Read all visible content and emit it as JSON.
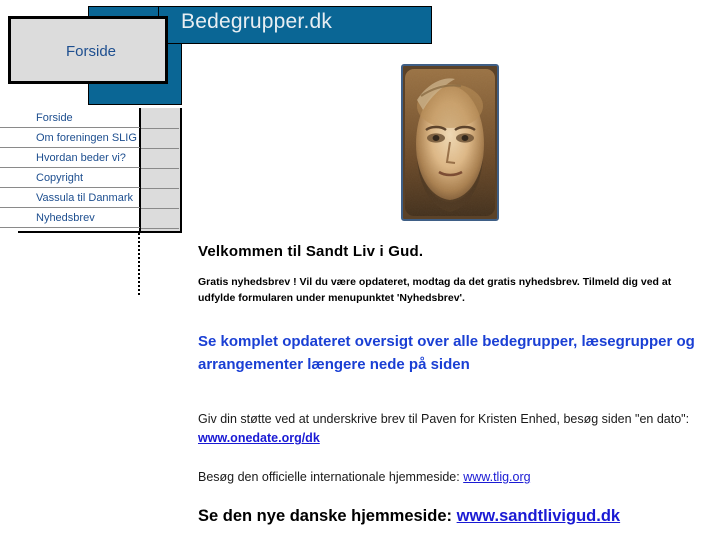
{
  "site": {
    "banner_title": "Bedegrupper.dk",
    "tab_label": "Forside",
    "accent_blue": "#0a6695",
    "link_blue": "#1a1ad4",
    "heading_blue": "#1a3fd4",
    "menu_text_blue": "#1d4e8f",
    "panel_grey": "#dcdcdc"
  },
  "menu": {
    "items": [
      {
        "label": "Forside"
      },
      {
        "label": "Om foreningen SLIG"
      },
      {
        "label": "Hvordan beder vi?"
      },
      {
        "label": "Copyright"
      },
      {
        "label": "Vassula til Danmark"
      },
      {
        "label": "Nyhedsbrev"
      }
    ]
  },
  "portrait": {
    "alt": "holy-face-of-jesus-portrait"
  },
  "content": {
    "welcome_heading": "Velkommen til Sandt Liv i Gud.",
    "newsletter_paragraph": "Gratis nyhedsbrev ! Vil du være opdateret, modtag da det gratis nyhedsbrev. Tilmeld dig ved at udfylde formularen under menupunktet 'Nyhedsbrev'.",
    "overview_heading": "Se komplet opdateret oversigt over alle bedegrupper, læsegrupper og arrangementer længere nede på siden",
    "support_text_before": "Giv din støtte ved at underskrive brev til Paven for Kristen Enhed, besøg siden \"en dato\": ",
    "support_link": "www.onedate.org/dk",
    "official_text_before": "Besøg den officielle internationale hjemmeside: ",
    "official_link": "www.tlig.org",
    "newsite_text_before": "Se den nye danske hjemmeside: ",
    "newsite_link": "www.sandtlivigud.dk"
  }
}
